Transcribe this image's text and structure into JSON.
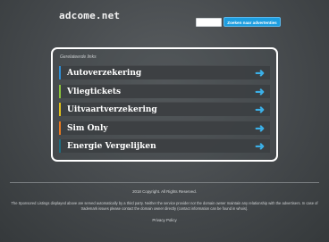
{
  "header": {
    "logo": "adcome.net",
    "search_value": "",
    "search_button_label": "Zoeken naar advertenties"
  },
  "panel": {
    "title": "Gerelateerde links",
    "links": [
      {
        "label": "Autoverzekering",
        "color": "#2f8fd6",
        "icon": "arrow-right-icon"
      },
      {
        "label": "Vliegtickets",
        "color": "#8cc43a",
        "icon": "arrow-right-icon"
      },
      {
        "label": "Uitvaartverzekering",
        "color": "#e3c21a",
        "icon": "arrow-right-icon"
      },
      {
        "label": "Sim Only",
        "color": "#ea7a1f",
        "icon": "arrow-right-icon"
      },
      {
        "label": "Energie Vergelijken",
        "color": "#1f6d80",
        "icon": "arrow-right-icon"
      }
    ],
    "arrow_color": "#3bb0e8"
  },
  "footer": {
    "copyright": "2018 Copyright. All Rights Reserved.",
    "disclaimer": "The Sponsored Listings displayed above are served automatically by a third party. Neither the service provider nor the domain owner maintain any relationship with the advertisers. In case of trademark issues please contact the domain owner directly (contact information can be found in whois).",
    "privacy_label": "Privacy Policy"
  }
}
